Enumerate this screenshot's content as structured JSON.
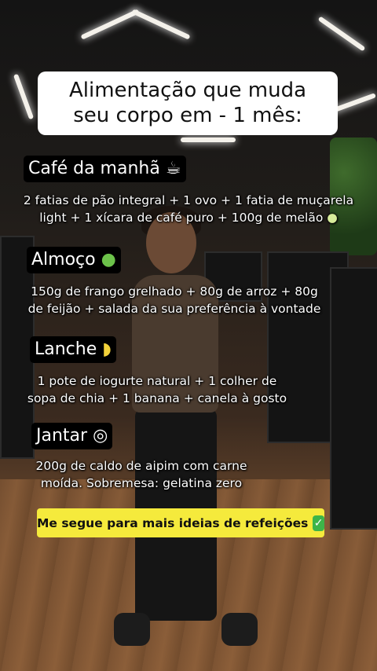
{
  "title": {
    "line1": "Alimentação que muda",
    "line2": "seu corpo em - 1 mês:"
  },
  "meals": [
    {
      "heading": "Café da manhã",
      "icon": "coffee-icon",
      "icon_glyph": "☕",
      "lines": [
        "2 fatias de pão integral + 1 ovo + 1 fatia de muçarela",
        "light + 1 xícara de café puro  + 100g de melão"
      ],
      "trailing_icon": "melon-icon",
      "trailing_glyph": "●"
    },
    {
      "heading": "Almoço",
      "icon": "salad-icon",
      "icon_glyph": "●",
      "lines": [
        "150g de frango grelhado + 80g de arroz + 80g",
        "de feijão + salada da sua preferência à vontade"
      ]
    },
    {
      "heading": "Lanche",
      "icon": "banana-icon",
      "icon_glyph": "◗",
      "lines": [
        "1 pote de iogurte natural + 1 colher de",
        "sopa de chia + 1 banana + canela à gosto"
      ]
    },
    {
      "heading": "Jantar",
      "icon": "plate-cutlery-icon",
      "icon_glyph": "◎",
      "lines": [
        "200g de caldo de aipim com carne",
        "moída. Sobremesa: gelatina zero"
      ]
    }
  ],
  "cta": {
    "label": "Me segue para mais ideias de refeições",
    "icon": "check-mark-icon",
    "icon_glyph": "✓"
  },
  "colors": {
    "cta_background": "#f5ea3c",
    "heading_background": "#000000",
    "title_background": "#ffffff",
    "check_green": "#3db449"
  }
}
